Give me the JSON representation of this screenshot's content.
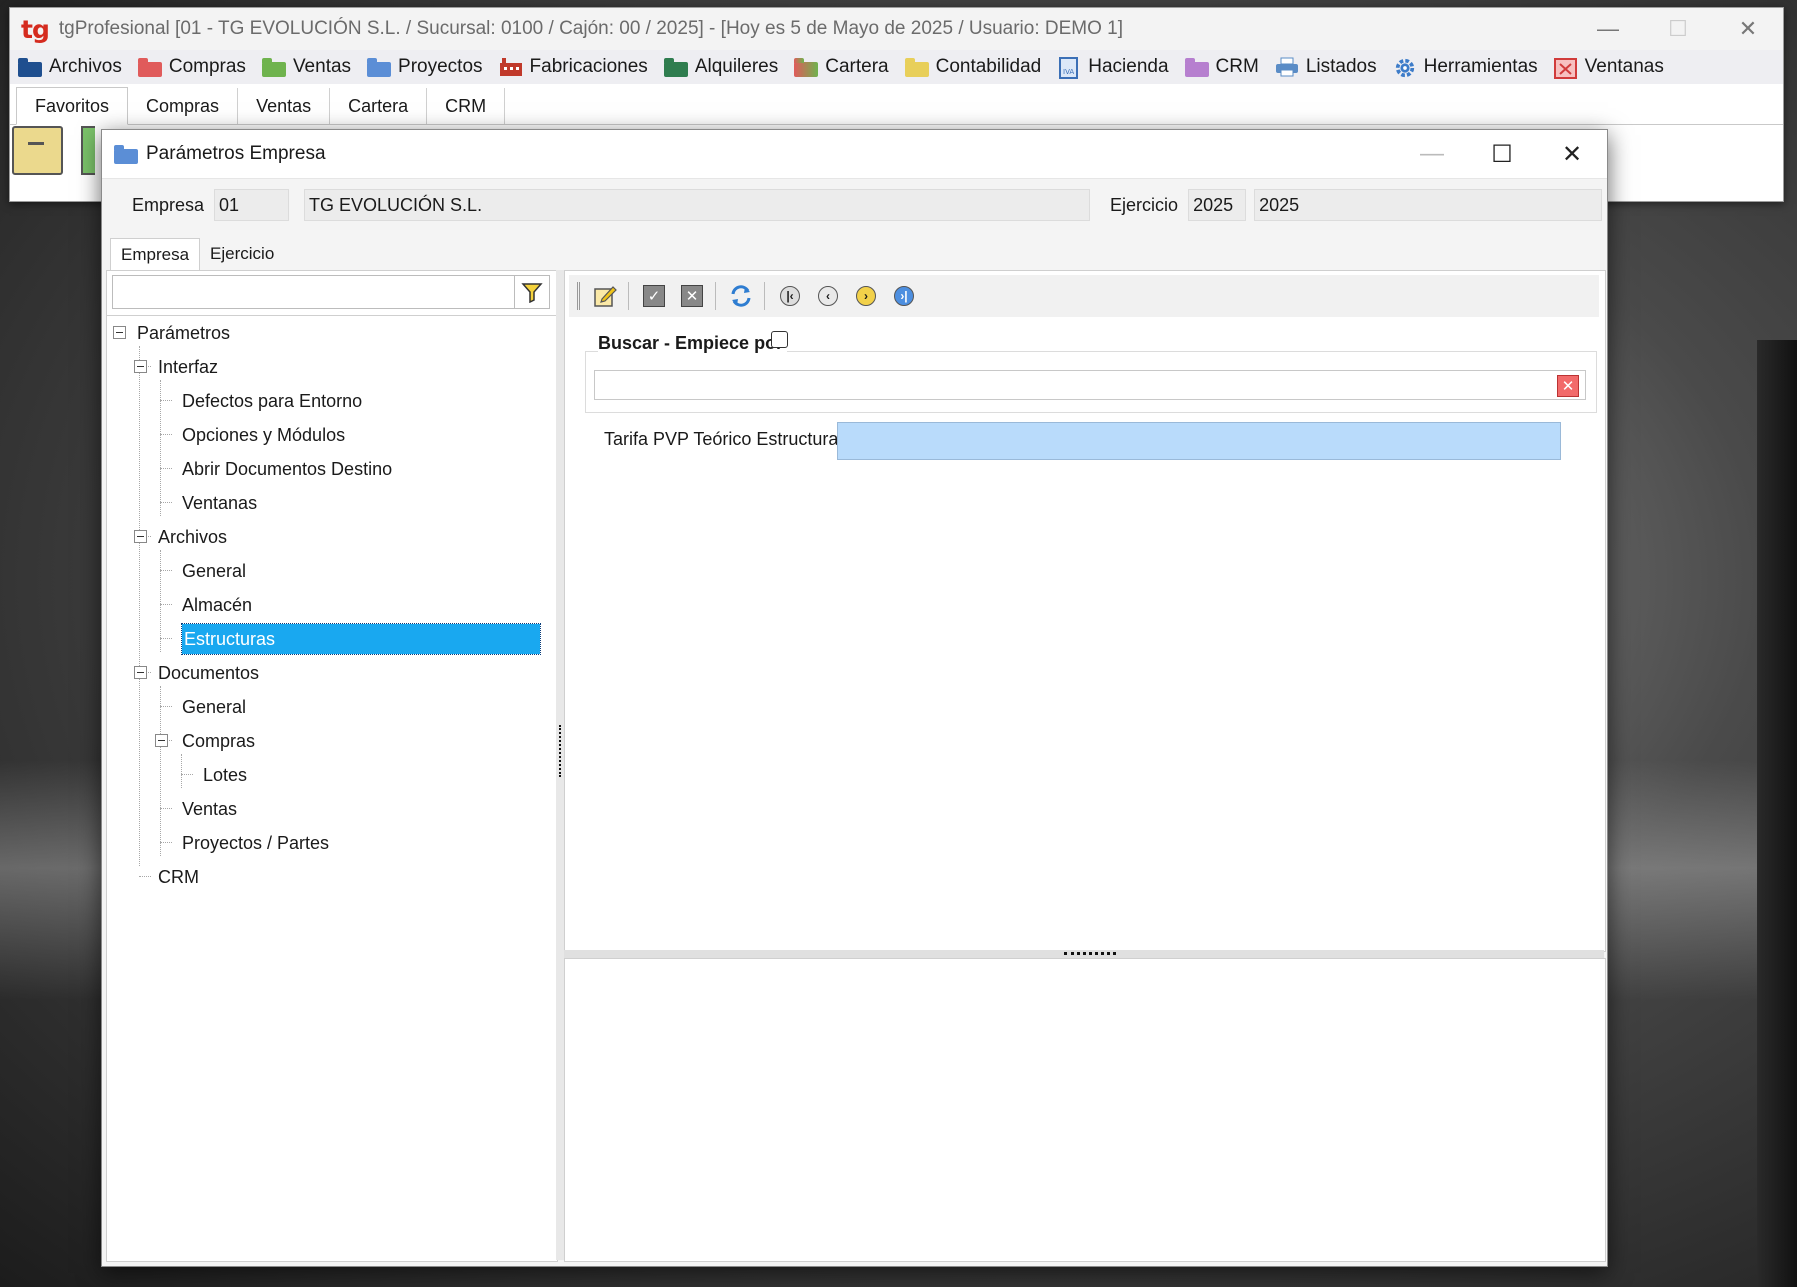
{
  "app": {
    "logo": "tg",
    "title": "tgProfesional [01 - TG EVOLUCIÓN S.L. / Sucursal: 0100 / Cajón: 00 / 2025] - [Hoy es 5 de Mayo de 2025 / Usuario: DEMO 1]"
  },
  "menu": [
    {
      "label": "Archivos",
      "icon": "folder-blue-icon",
      "color": "#1f4f8f"
    },
    {
      "label": "Compras",
      "icon": "folder-red-icon",
      "color": "#e05b5b"
    },
    {
      "label": "Ventas",
      "icon": "folder-green-icon",
      "color": "#6fb34e"
    },
    {
      "label": "Proyectos",
      "icon": "folder-blue-icon",
      "color": "#5b8ed6"
    },
    {
      "label": "Fabricaciones",
      "icon": "factory-icon",
      "color": "#c0392b"
    },
    {
      "label": "Alquileres",
      "icon": "folder-dark-green-icon",
      "color": "#2f7d4f"
    },
    {
      "label": "Cartera",
      "icon": "folder-multicolor-icon",
      "color": "#e0833b"
    },
    {
      "label": "Contabilidad",
      "icon": "folder-yellow-icon",
      "color": "#e8cf5a"
    },
    {
      "label": "Hacienda",
      "icon": "document-tax-icon",
      "color": "#3b6fb6"
    },
    {
      "label": "CRM",
      "icon": "folder-purple-icon",
      "color": "#b67fcf"
    },
    {
      "label": "Listados",
      "icon": "printer-icon",
      "color": "#5a8cc6"
    },
    {
      "label": "Herramientas",
      "icon": "gear-icon",
      "color": "#3d7cc9"
    },
    {
      "label": "Ventanas",
      "icon": "close-window-icon",
      "color": "#d13b3b"
    }
  ],
  "tabs": [
    "Favoritos",
    "Compras",
    "Ventas",
    "Cartera",
    "CRM"
  ],
  "dialog": {
    "title": "Parámetros Empresa",
    "empresa_label": "Empresa",
    "empresa_code": "01",
    "empresa_name": "TG EVOLUCIÓN S.L.",
    "ejercicio_label": "Ejercicio",
    "ejercicio_value1": "2025",
    "ejercicio_value2": "2025",
    "subtabs": [
      "Empresa",
      "Ejercicio"
    ],
    "tree": {
      "root": "Parámetros",
      "interfaz": "Interfaz",
      "defectos": "Defectos para Entorno",
      "opciones": "Opciones y Módulos",
      "abrir": "Abrir Documentos Destino",
      "ventanas": "Ventanas",
      "archivos": "Archivos",
      "arch_general": "General",
      "almacen": "Almacén",
      "estructuras": "Estructuras",
      "documentos": "Documentos",
      "doc_general": "General",
      "compras": "Compras",
      "lotes": "Lotes",
      "doc_ventas": "Ventas",
      "proyectos": "Proyectos / Partes",
      "crm": "CRM"
    },
    "buscar_label": "Buscar - Empiece por",
    "tarifa_label": "Tarifa PVP Teórico Estructuras",
    "colors": {
      "selection": "#19a8f0",
      "tarifa_field": "#b9dbfb",
      "logo": "#d52b1e"
    }
  }
}
